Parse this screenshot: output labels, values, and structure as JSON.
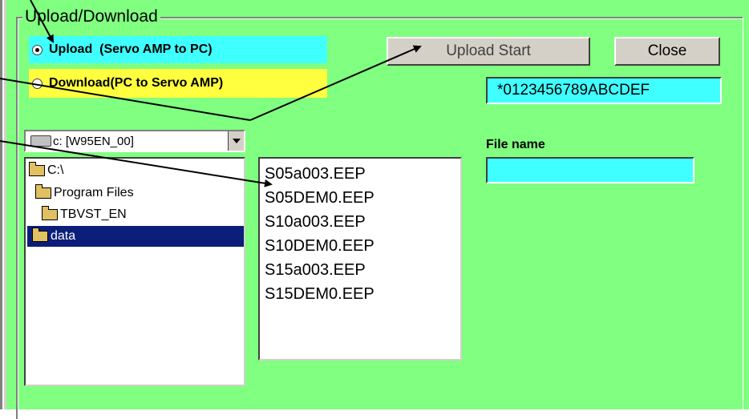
{
  "group": {
    "title": "Upload/Download"
  },
  "mode": {
    "upload_label": "Upload  (Servo AMP to PC)",
    "download_label": "Download(PC to Servo AMP)",
    "selected": "upload"
  },
  "buttons": {
    "upload_start": "Upload Start",
    "close": "Close"
  },
  "serial_value": "*0123456789ABCDEF",
  "drive": {
    "selected": "c: [W95EN_00]"
  },
  "directories": [
    {
      "label": "C:\\",
      "selected": false
    },
    {
      "label": "Program Files",
      "selected": false
    },
    {
      "label": "TBVST_EN",
      "selected": false
    },
    {
      "label": "data",
      "selected": true
    }
  ],
  "files": [
    "S05a003.EEP",
    "S05DEM0.EEP",
    "S10a003.EEP",
    "S10DEM0.EEP",
    "S15a003.EEP",
    "S15DEM0.EEP"
  ],
  "file_name": {
    "label": "File name",
    "value": ""
  },
  "colors": {
    "panel": "#80ff80",
    "upload_row": "#40ffff",
    "download_row": "#ffff40",
    "field": "#40ffff",
    "selection": "#0a1e7a"
  }
}
